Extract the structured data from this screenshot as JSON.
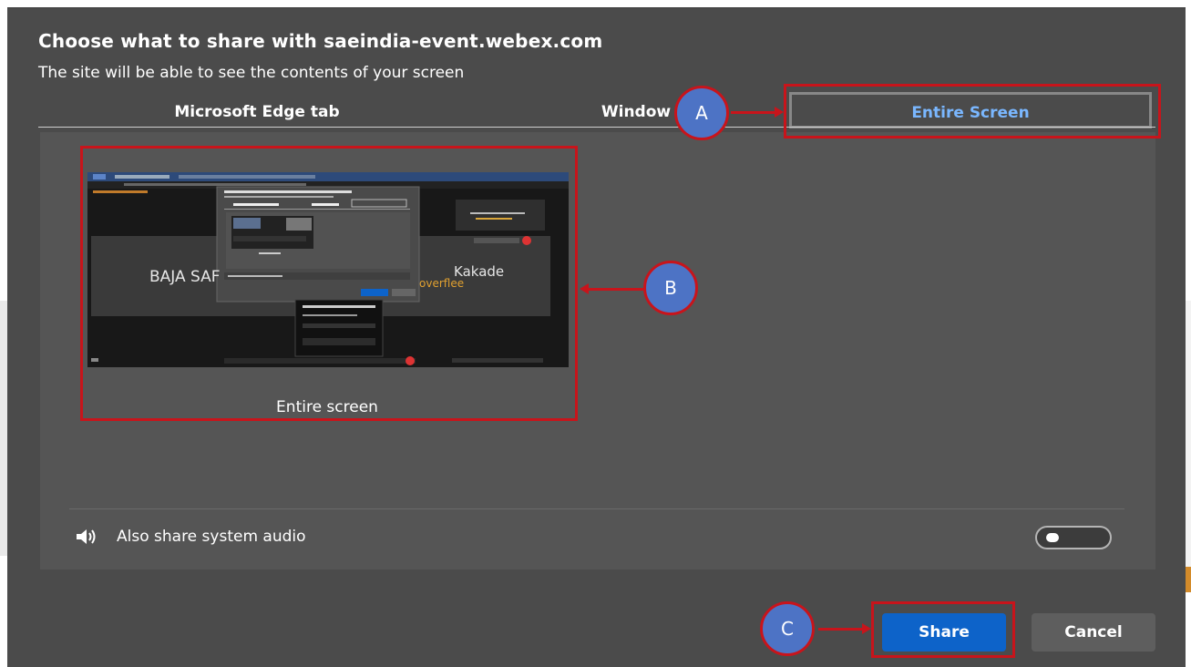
{
  "dialog": {
    "title": "Choose what to share with saeindia-event.webex.com",
    "subtitle": "The site will be able to see the contents of your screen"
  },
  "tabs": [
    {
      "label": "Microsoft Edge tab",
      "selected": false
    },
    {
      "label": "Window",
      "selected": false
    },
    {
      "label": "Entire Screen",
      "selected": true
    }
  ],
  "screen_option": {
    "label": "Entire screen",
    "preview": {
      "left_text": "BAJA SAF",
      "right_name": "Kakade",
      "right_sub": "overflee"
    }
  },
  "audio": {
    "icon": "speaker-icon",
    "label": "Also share system audio",
    "enabled": false
  },
  "buttons": {
    "share": "Share",
    "cancel": "Cancel"
  },
  "annotations": {
    "a": "A",
    "b": "B",
    "c": "C"
  },
  "colors": {
    "dialog_bg": "#4b4b4b",
    "content_bg": "#555555",
    "accent": "#0d63c9",
    "selected_tab_text": "#7ab7ff",
    "annotation_red": "#c8141b",
    "annotation_blue": "#4d73c5"
  }
}
